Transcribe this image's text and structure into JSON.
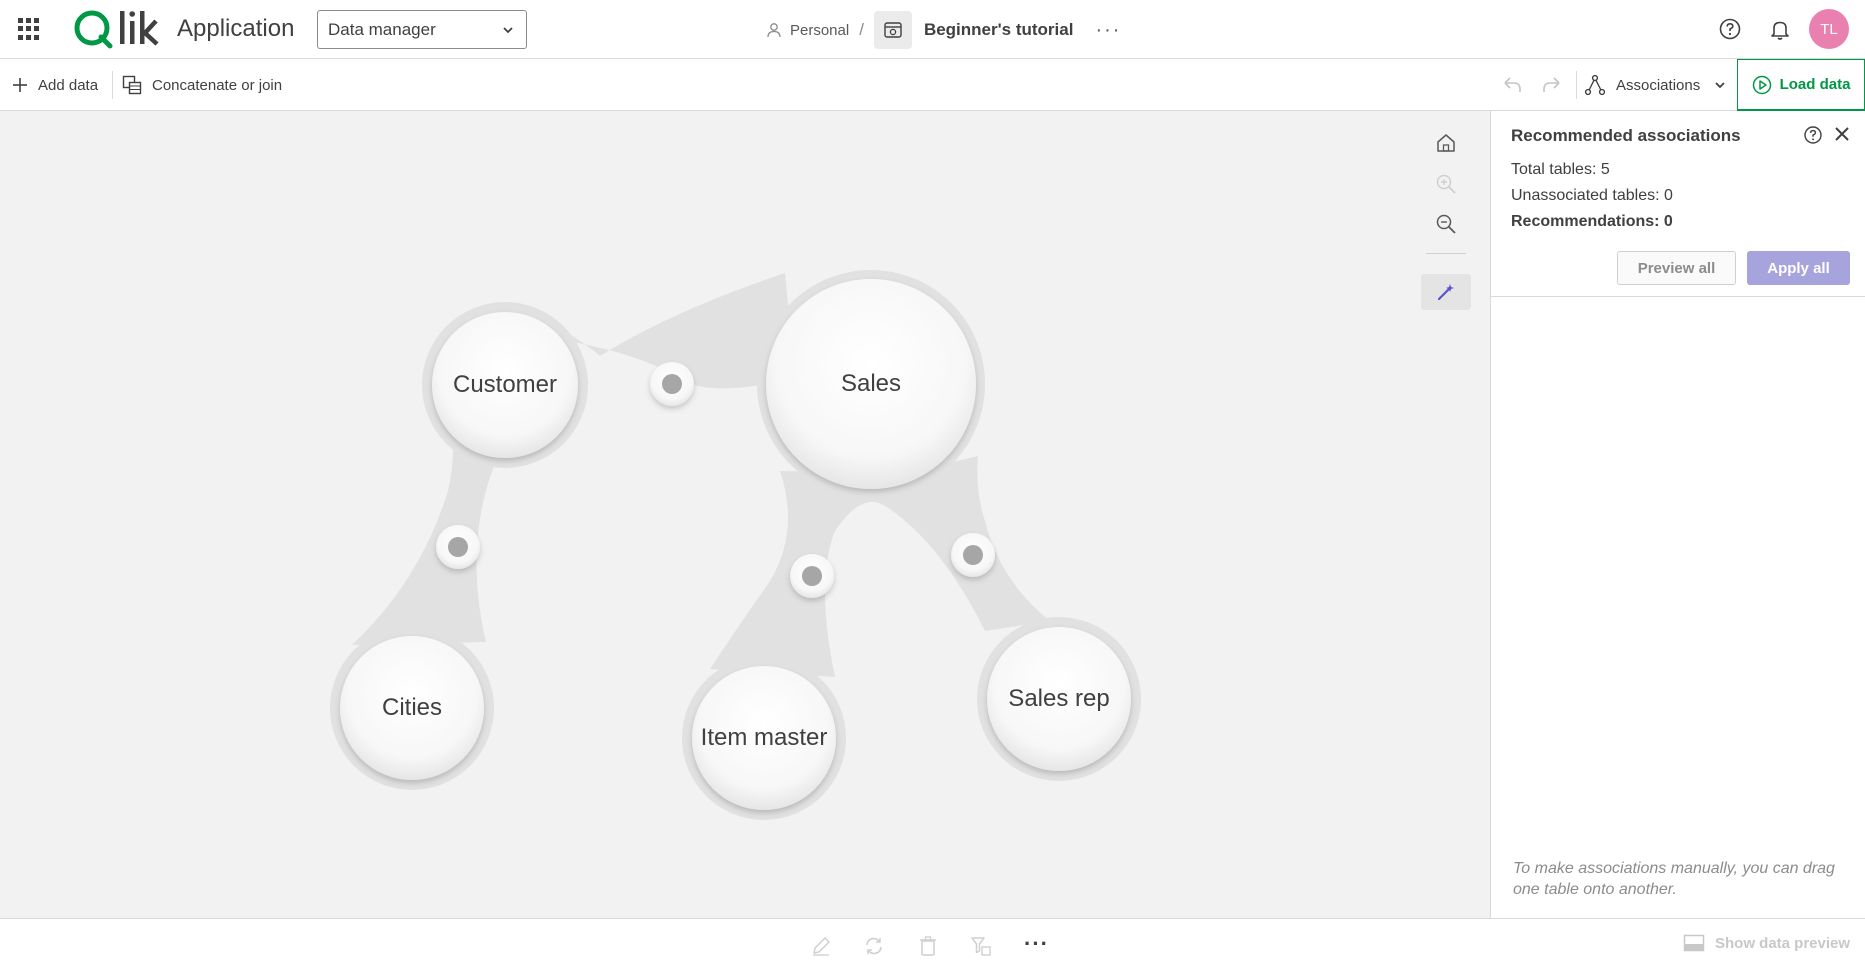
{
  "header": {
    "app_name": "Application",
    "view_select": {
      "selected": "Data manager"
    },
    "breadcrumb": {
      "space": "Personal",
      "separator": "/",
      "app_title": "Beginner's tutorial",
      "more": "···"
    },
    "avatar_initials": "TL"
  },
  "toolbar": {
    "add_data": "Add data",
    "concat_join": "Concatenate or join",
    "view_mode": "Associations",
    "load_data": "Load data"
  },
  "canvas": {
    "tables": [
      "Customer",
      "Sales",
      "Cities",
      "Item master",
      "Sales rep"
    ],
    "associations": [
      {
        "from": "Customer",
        "to": "Sales"
      },
      {
        "from": "Customer",
        "to": "Cities"
      },
      {
        "from": "Sales",
        "to": "Item master"
      },
      {
        "from": "Sales",
        "to": "Sales rep"
      }
    ]
  },
  "panel": {
    "title": "Recommended associations",
    "total_tables": "Total tables: 5",
    "unassociated_tables": "Unassociated tables: 0",
    "recommendations": "Recommendations: 0",
    "preview_all": "Preview all",
    "apply_all": "Apply all",
    "hint": "To make associations manually, you can drag one table onto another."
  },
  "bottom": {
    "more": "···",
    "show_data_preview": "Show data preview"
  },
  "colors": {
    "brand_green": "#009845",
    "accent_purple": "#a7a3dc",
    "avatar_pink": "#ea80b0",
    "canvas_bg": "#f2f2f2"
  }
}
